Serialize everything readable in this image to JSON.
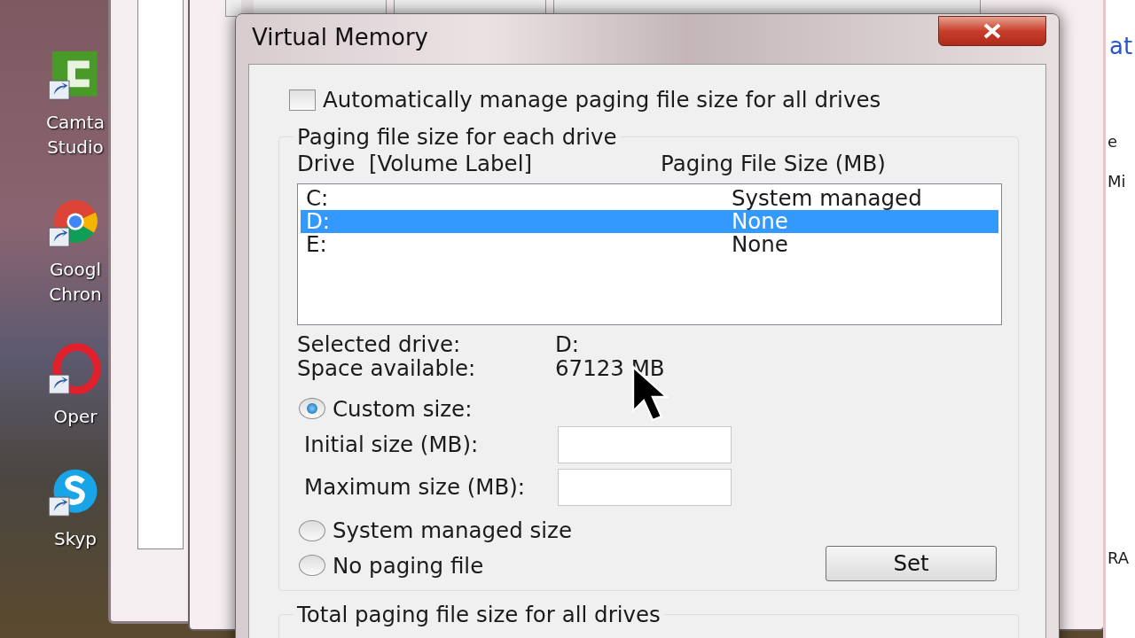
{
  "desktop_icons": [
    {
      "kind": "camtasia",
      "lines": [
        "Camta",
        "Studio"
      ]
    },
    {
      "kind": "chrome",
      "lines": [
        "Googl",
        "Chron"
      ]
    },
    {
      "kind": "opera",
      "lines": [
        "Oper"
      ]
    },
    {
      "kind": "skype",
      "lines": [
        "Skyp"
      ]
    }
  ],
  "background_window": {
    "link": "at",
    "texts": [
      "e",
      "Mi",
      "RA"
    ]
  },
  "dialog": {
    "title": "Virtual Memory",
    "auto_manage": {
      "label": "Automatically manage paging file size for all drives",
      "checked": false
    },
    "paging_group": {
      "title": "Paging file size for each drive",
      "columns": [
        "Drive  [Volume Label]",
        "Paging File Size (MB)"
      ],
      "drives": [
        {
          "drive": "C:",
          "size": "System managed",
          "selected": false
        },
        {
          "drive": "D:",
          "size": "None",
          "selected": true
        },
        {
          "drive": "E:",
          "size": "None",
          "selected": false
        }
      ],
      "info": [
        {
          "label": "Selected drive:",
          "value": "D:"
        },
        {
          "label": "Space available:",
          "value": "67123 MB"
        }
      ],
      "options": [
        {
          "kind": "custom",
          "label": "Custom size:",
          "selected": true,
          "fields": [
            {
              "label": "Initial size (MB):"
            },
            {
              "label": "Maximum size (MB):"
            }
          ]
        },
        {
          "kind": "plain",
          "label": "System managed size",
          "selected": false
        },
        {
          "kind": "plain",
          "label": "No paging file",
          "selected": false
        }
      ],
      "set_button": "Set"
    },
    "total_group": {
      "title": "Total paging file size for all drives"
    }
  }
}
